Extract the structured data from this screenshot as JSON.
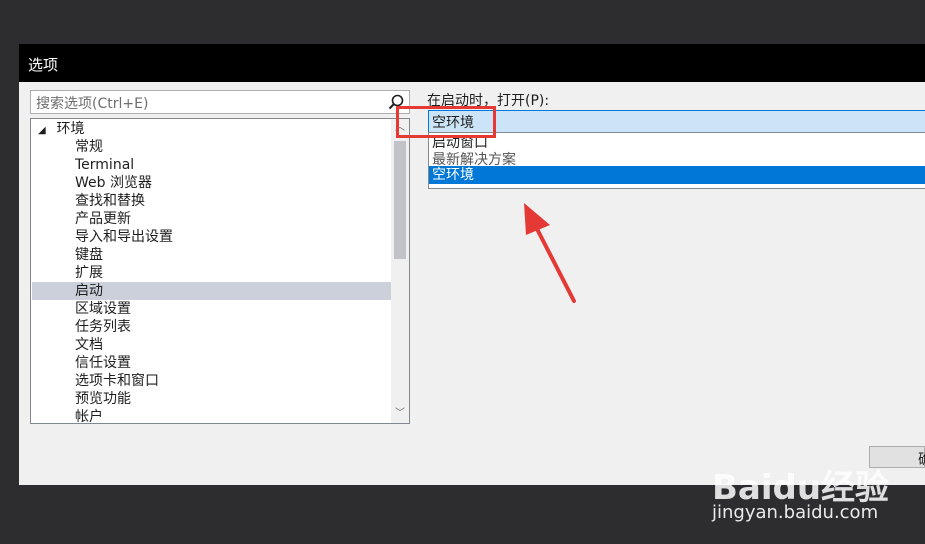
{
  "dialog": {
    "title": "选项"
  },
  "search": {
    "placeholder": "搜索选项(Ctrl+E)"
  },
  "tree": {
    "root": "环境",
    "items": [
      "常规",
      "Terminal",
      "Web 浏览器",
      "查找和替换",
      "产品更新",
      "导入和导出设置",
      "键盘",
      "扩展",
      "启动",
      "区域设置",
      "任务列表",
      "文档",
      "信任设置",
      "选项卡和窗口",
      "预览功能",
      "帐户"
    ],
    "selected": "启动"
  },
  "startup": {
    "label": "在启动时，打开(P):",
    "value": "空环境",
    "options": [
      "启动窗口",
      "最新解决方案",
      "空环境"
    ],
    "selected_option": "空环境"
  },
  "footer": {
    "ok_partial": "确"
  },
  "watermark": {
    "logo": "Baidu经验",
    "url": "jingyan.baidu.com"
  },
  "colors": {
    "selection": "#0078d7",
    "tree_selection": "#ccd0db",
    "annotation": "#e53935"
  }
}
